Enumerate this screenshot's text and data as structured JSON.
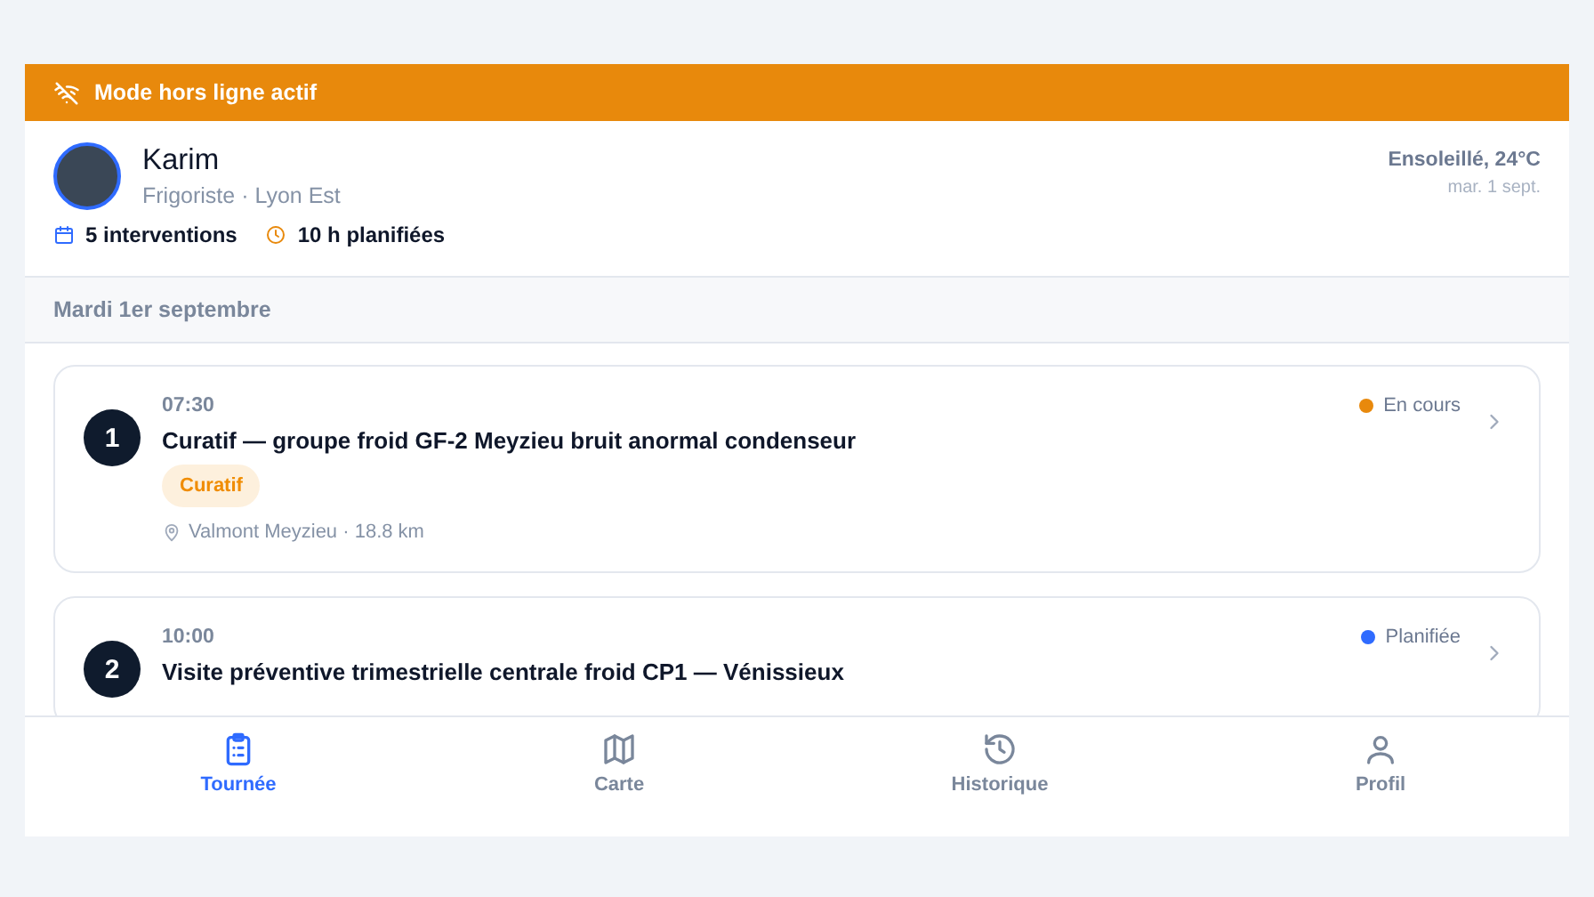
{
  "banner": {
    "text": "Mode hors ligne actif"
  },
  "profile": {
    "name": "Karim",
    "role": "Frigoriste · Lyon Est",
    "weather": "Ensoleillé, 24°C",
    "date": "mar. 1 sept.",
    "stats": [
      {
        "kind": "calendar",
        "label": "5 interventions"
      },
      {
        "kind": "clock",
        "label": "10 h planifiées"
      }
    ]
  },
  "day_header": "Mardi 1er septembre",
  "interventions": [
    {
      "number": "1",
      "time": "07:30",
      "title": "Curatif — groupe froid GF-2 Meyzieu bruit anormal condenseur",
      "tag": {
        "label": "Curatif",
        "color": "#f08c00"
      },
      "location": "Valmont Meyzieu · 18.8 km",
      "status": {
        "label": "En cours",
        "color": "#e8890c"
      }
    },
    {
      "number": "2",
      "time": "10:00",
      "title": "Visite préventive trimestrielle centrale froid CP1 — Vénissieux",
      "status": {
        "label": "Planifiée",
        "color": "#2f6bff"
      }
    }
  ],
  "nav": [
    {
      "kind": "clipboard",
      "label": "Tournée",
      "selected": true
    },
    {
      "kind": "map",
      "label": "Carte",
      "selected": false
    },
    {
      "kind": "history",
      "label": "Historique",
      "selected": false
    },
    {
      "kind": "user",
      "label": "Profil",
      "selected": false
    }
  ]
}
